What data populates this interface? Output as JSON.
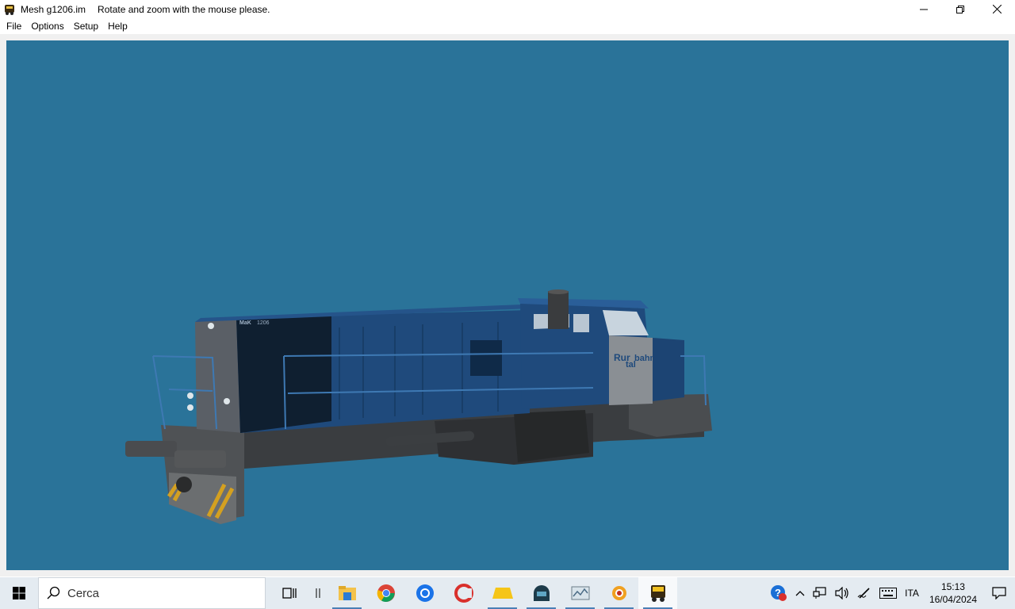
{
  "window": {
    "title": "Mesh g1206.im",
    "hint": "Rotate and zoom with the mouse please.",
    "icon": "locomotive-app-icon"
  },
  "menu": {
    "items": [
      "File",
      "Options",
      "Setup",
      "Help"
    ]
  },
  "viewport": {
    "background": "#2a7399",
    "model": "locomotive-3d-model",
    "locomotive_labels": {
      "maker": "MaK",
      "number": "1206",
      "brand_line1": "Rur",
      "brand_line2": "tal",
      "brand_line3": "bahn",
      "brand_sub": "Cargo"
    }
  },
  "taskbar": {
    "search_placeholder": "Cerca",
    "apps": [
      "task-view-icon",
      "file-explorer-icon",
      "chrome-icon",
      "thunderbird-icon",
      "ccleaner-icon",
      "folder-yellow-icon",
      "train-dome-icon",
      "map-icon",
      "viewer-eye-icon",
      "locomotive-app-icon"
    ],
    "language": "ITA",
    "time": "15:13",
    "date": "16/04/2024"
  }
}
